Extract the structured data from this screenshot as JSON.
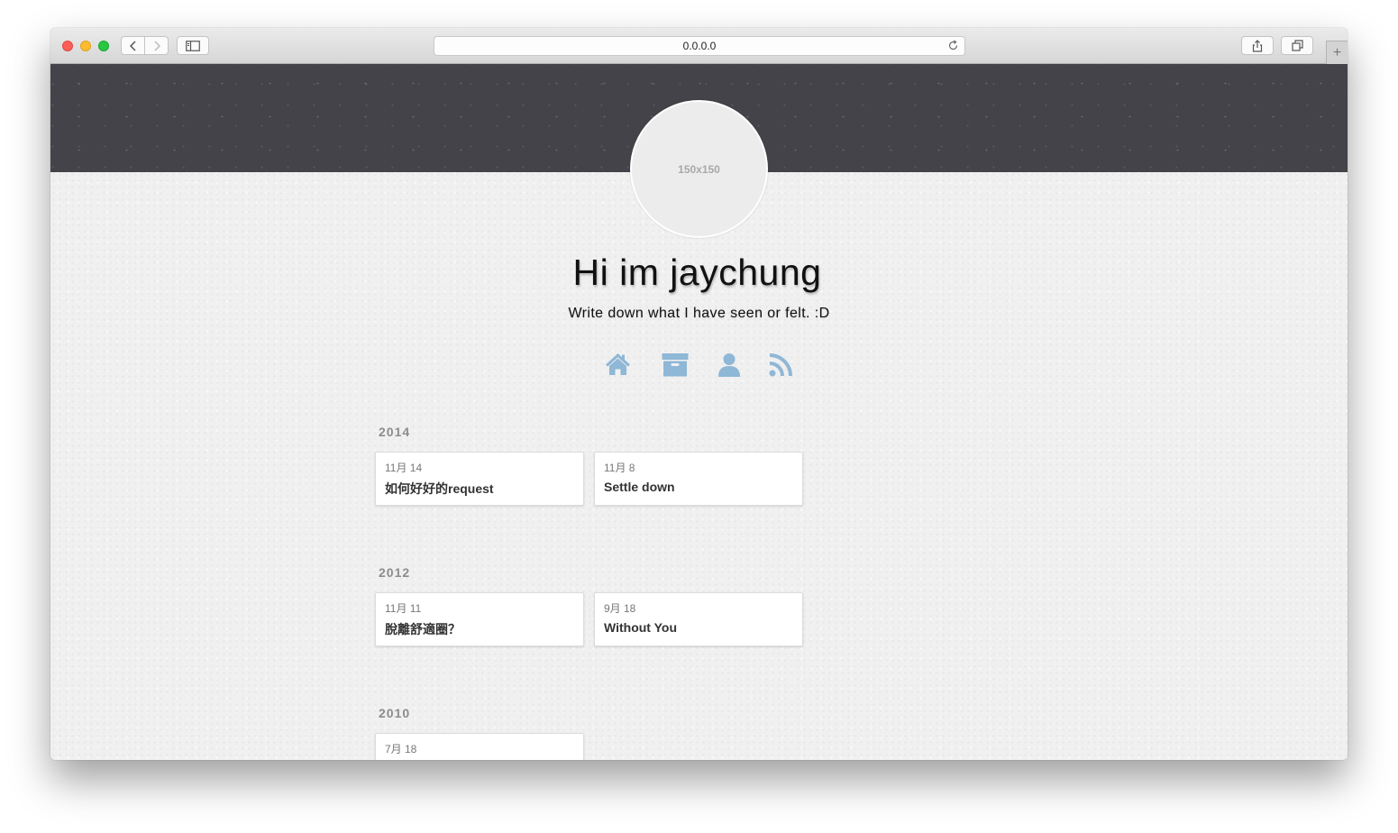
{
  "browser": {
    "url": "0.0.0.0"
  },
  "profile": {
    "avatar_text": "150x150",
    "title": "Hi im jaychung",
    "subtitle": "Write down what I have seen or felt. :D"
  },
  "nav": {
    "icons": [
      "home-icon",
      "archive-icon",
      "user-icon",
      "rss-icon"
    ],
    "color": "#8fb7d6"
  },
  "archive": [
    {
      "year": "2014",
      "posts": [
        {
          "date": "11月 14",
          "title": "如何好好的request"
        },
        {
          "date": "11月 8",
          "title": "Settle down"
        }
      ]
    },
    {
      "year": "2012",
      "posts": [
        {
          "date": "11月 11",
          "title": "脫離舒適圈？"
        },
        {
          "date": "9月 18",
          "title": "Without You"
        }
      ]
    },
    {
      "year": "2010",
      "posts": [
        {
          "date": "7月 18",
          "title": ""
        }
      ]
    }
  ]
}
